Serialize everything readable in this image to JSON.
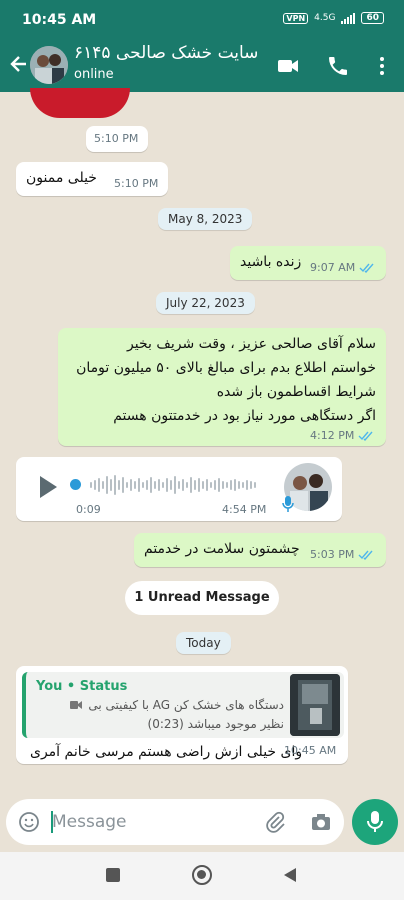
{
  "status_bar": {
    "time": "10:45 AM",
    "vpn": "VPN",
    "network": "4.5G",
    "battery": "60"
  },
  "header": {
    "title": "سایت خشک صالحی ۶۱۴۵",
    "subtitle": "online"
  },
  "messages": {
    "m1": {
      "time": "5:10 PM"
    },
    "m2": {
      "text": "خیلی ممنون",
      "time": "5:10 PM"
    },
    "date1": "May 8, 2023",
    "m3": {
      "text": "زنده باشید",
      "time": "9:07 AM"
    },
    "date2": "July 22, 2023",
    "m4": {
      "lines": [
        "سلام آقای صالحی عزیز ، وقت شریف بخیر",
        "خواستم اطلاع بدم برای مبالغ بالای ۵۰ میلیون تومان",
        "شرایط اقساطمون باز شده",
        "اگر دستگاهی مورد نیاز بود در خدمتتون هستم"
      ],
      "time": "4:12 PM"
    },
    "voice": {
      "duration": "0:09",
      "time": "4:54 PM"
    },
    "m5": {
      "text": "چشمتون سلامت در خدمتم",
      "time": "5:03 PM"
    },
    "unread": "1 Unread Message",
    "date3": "Today",
    "m6": {
      "quote_title": "You • Status",
      "quote_line1": "دستگاه های خشک کن AG با کیفیتی بی",
      "quote_line2": "نظیر موجود میباشد (0:23)",
      "text": "وای خیلی ازش راضی هستم مرسی خانم آمری",
      "time": "10:45 AM"
    }
  },
  "input": {
    "placeholder": "Message"
  },
  "colors": {
    "header": "#1a7a6b",
    "outgoing": "#dcf8c6",
    "accent": "#1da57b",
    "ticks": "#4fb6ec"
  }
}
